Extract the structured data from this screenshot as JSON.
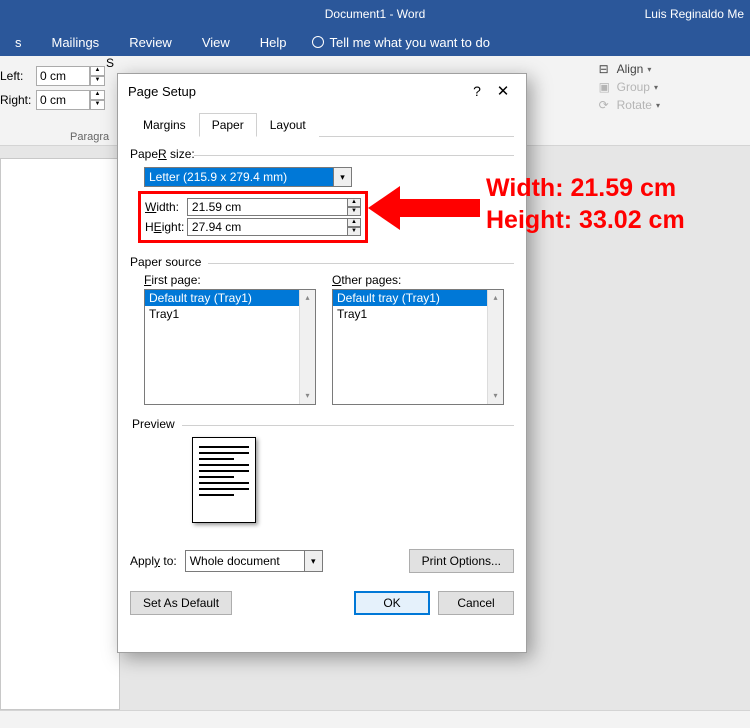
{
  "titlebar": {
    "doc": "Document1  -  Word",
    "user": "Luis Reginaldo Me"
  },
  "ribbonTabs": {
    "items": [
      "s",
      "Mailings",
      "Review",
      "View",
      "Help"
    ],
    "tell": "Tell me what you want to do"
  },
  "ribbon": {
    "s_label": "S",
    "left_label": "Left:",
    "left_value": "0 cm",
    "right_label": "Right:",
    "right_value": "0 cm",
    "group": "Paragra",
    "align": "Align",
    "group_cmd": "Group",
    "rotate": "Rotate"
  },
  "dialog": {
    "title": "Page Setup",
    "tabs": {
      "margins": "Margins",
      "paper": "Paper",
      "layout": "Layout"
    },
    "paper_size": "Paper size:",
    "paper_size_u": "R",
    "size_value": "Letter (215.9 x 279.4 mm)",
    "width_label": "Width:",
    "width_u": "W",
    "width_value": "21.59 cm",
    "height_label": "Height:",
    "height_u": "E",
    "height_value": "27.94 cm",
    "paper_source": "Paper source",
    "first_page": "First page:",
    "first_u": "F",
    "other_pages": "Other pages:",
    "other_u": "O",
    "tray_default": "Default tray (Tray1)",
    "tray1": "Tray1",
    "preview": "Preview",
    "apply_to": "Apply to:",
    "apply_u": "y",
    "apply_value": "Whole document",
    "print_options": "Print Options...",
    "set_default": "Set As Default",
    "ok": "OK",
    "cancel": "Cancel"
  },
  "annot": {
    "line1": "Width: 21.59 cm",
    "line2": "Height: 33.02 cm"
  }
}
